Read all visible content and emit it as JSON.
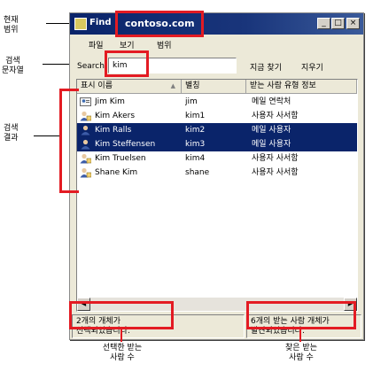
{
  "callouts": {
    "scope": [
      "현재",
      "범위"
    ],
    "search_string": [
      "검색",
      "문자열"
    ],
    "results": [
      "검색",
      "결과"
    ],
    "selected_count": [
      "선택한 받는",
      "사람 수"
    ],
    "found_count": [
      "찾은 받는",
      "사람 수"
    ]
  },
  "window": {
    "title": "Find",
    "scope": "contoso.com",
    "buttons": {
      "minimize": "_",
      "maximize": "□",
      "close": "×"
    }
  },
  "menu": {
    "items": [
      "파일",
      "보기",
      "범위"
    ]
  },
  "search": {
    "label": "Search:",
    "value": "kim",
    "find_now": "지금 찾기",
    "clear": "지우기"
  },
  "list": {
    "columns": [
      "표시 이름",
      "별칭",
      "받는 사람 유형 정보"
    ],
    "rows": [
      {
        "name": "Jim Kim",
        "alias": "jim",
        "type": "메일 연락처",
        "icon": "contact-icon",
        "selected": false
      },
      {
        "name": "Kim Akers",
        "alias": "kim1",
        "type": "사용자 사서함",
        "icon": "mailbox-user-icon",
        "selected": false
      },
      {
        "name": "Kim Ralls",
        "alias": "kim2",
        "type": "메일 사용자",
        "icon": "mail-user-icon",
        "selected": true
      },
      {
        "name": "Kim Steffensen",
        "alias": "kim3",
        "type": "메일 사용자",
        "icon": "mail-user-icon",
        "selected": true
      },
      {
        "name": "Kim Truelsen",
        "alias": "kim4",
        "type": "사용자 사서함",
        "icon": "mailbox-user-icon",
        "selected": false
      },
      {
        "name": "Shane Kim",
        "alias": "shane",
        "type": "사용자 사서함",
        "icon": "mailbox-user-icon",
        "selected": false
      }
    ]
  },
  "status": {
    "selected": [
      "2개의 개체가",
      "선택되었습니다."
    ],
    "found": [
      "6개의 받는 사람 개체가",
      "발견되었습니다."
    ]
  },
  "colors": {
    "highlight": "#e31b23",
    "selection": "#0a246a",
    "titlebar": "#0a246a"
  }
}
